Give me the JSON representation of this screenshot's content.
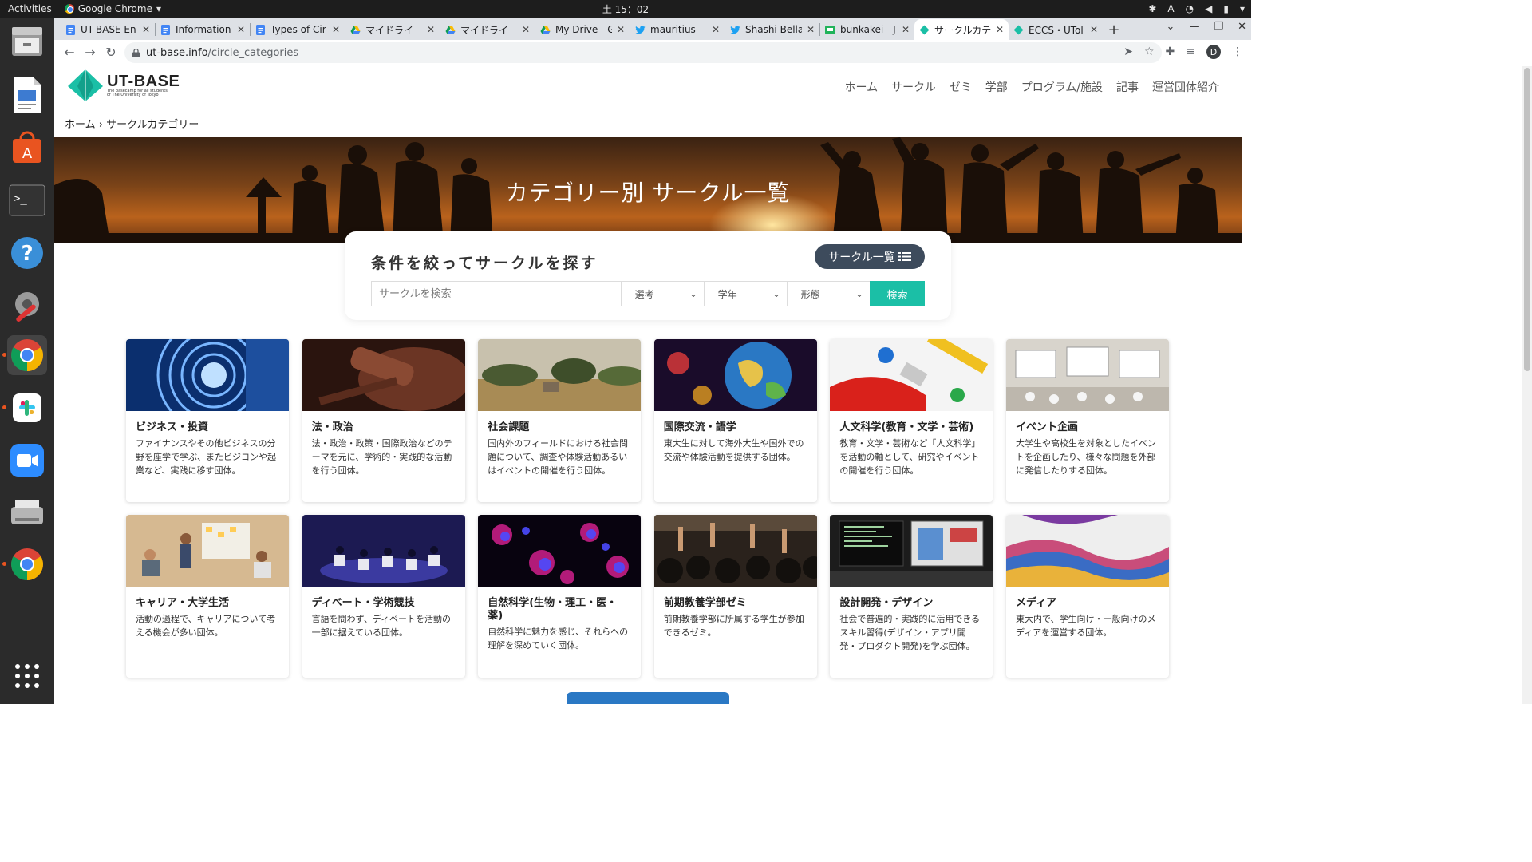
{
  "system": {
    "activities": "Activities",
    "app_name": "Google Chrome",
    "clock": "土 15：02",
    "ime": "A"
  },
  "tabs": [
    {
      "label": "UT-BASE En",
      "icon": "docs-icon",
      "active": false
    },
    {
      "label": "Information",
      "icon": "docs-icon",
      "active": false
    },
    {
      "label": "Types of Cir",
      "icon": "docs-icon",
      "active": false
    },
    {
      "label": "マイドライ",
      "icon": "drive-icon",
      "active": false
    },
    {
      "label": "マイドライ",
      "icon": "drive-icon",
      "active": false
    },
    {
      "label": "My Drive - G",
      "icon": "drive-icon",
      "active": false
    },
    {
      "label": "mauritius - T",
      "icon": "twitter-icon",
      "active": false
    },
    {
      "label": "Shashi Bella",
      "icon": "twitter-icon",
      "active": false
    },
    {
      "label": "bunkakei - J",
      "icon": "hatena-icon",
      "active": false
    },
    {
      "label": "サークルカテ",
      "icon": "utbase-icon",
      "active": true
    },
    {
      "label": "ECCS・UTol",
      "icon": "utbase-icon",
      "active": false
    }
  ],
  "address": {
    "host": "ut-base.info",
    "path": "/circle_categories"
  },
  "profile_initial": "D",
  "site": {
    "logo_name": "UT-BASE",
    "logo_tagline": "The basecamp for all students of The University of Tokyo",
    "nav": [
      "ホーム",
      "サークル",
      "ゼミ",
      "学部",
      "プログラム/施設",
      "記事",
      "運営団体紹介"
    ],
    "breadcrumb_home": "ホーム",
    "breadcrumb_sep": "›",
    "breadcrumb_current": "サークルカテゴリー",
    "hero_title": "カテゴリー別 サークル一覧",
    "search_title": "条件を絞ってサークルを探す",
    "list_button": "サークル一覧",
    "search_placeholder": "サークルを検索",
    "selects": [
      "--選考--",
      "--学年--",
      "--形態--"
    ],
    "search_button": "検索"
  },
  "categories": [
    {
      "title": "ビジネス・投資",
      "desc": "ファイナンスやその他ビジネスの分野を座学で学ぶ、またビジコンや起業など、実践に移す団体。",
      "img": "business-image"
    },
    {
      "title": "法・政治",
      "desc": "法・政治・政策・国際政治などのテーマを元に、学術的・実践的な活動を行う団体。",
      "img": "gavel-image"
    },
    {
      "title": "社会課題",
      "desc": "国内外のフィールドにおける社会問題について、調査や体験活動あるいはイベントの開催を行う団体。",
      "img": "field-image"
    },
    {
      "title": "国際交流・語学",
      "desc": "東大生に対して海外大生や国外での交流や体験活動を提供する団体。",
      "img": "globe-image"
    },
    {
      "title": "人文科学(教育・文学・芸術)",
      "desc": "教育・文学・芸術など「人文科学」を活動の軸として、研究やイベントの開催を行う団体。",
      "img": "paint-image"
    },
    {
      "title": "イベント企画",
      "desc": "大学生や高校生を対象としたイベントを企画したり、様々な問題を外部に発信したりする団体。",
      "img": "hall-image"
    },
    {
      "title": "キャリア・大学生活",
      "desc": "活動の過程で、キャリアについて考える機会が多い団体。",
      "img": "meeting-image"
    },
    {
      "title": "ディベート・学術競技",
      "desc": "言語を問わず、ディベートを活動の一部に据えている団体。",
      "img": "debate-image"
    },
    {
      "title": "自然科学(生物・理工・医・薬)",
      "desc": "自然科学に魅力を感じ、それらへの理解を深めていく団体。",
      "img": "cells-image"
    },
    {
      "title": "前期教養学部ゼミ",
      "desc": "前期教養学部に所属する学生が参加できるゼミ。",
      "img": "hands-image"
    },
    {
      "title": "設計開発・デザイン",
      "desc": "社会で普遍的・実践的に活用できるスキル習得(デザイン・アプリ開発・プロダクト開発)を学ぶ団体。",
      "img": "code-image"
    },
    {
      "title": "メディア",
      "desc": "東大内で、学生向け・一般向けのメディアを運営する団体。",
      "img": "magazine-image"
    }
  ],
  "colors": {
    "brand_teal": "#1bbfa6",
    "button_navy": "#3d4b5c"
  }
}
